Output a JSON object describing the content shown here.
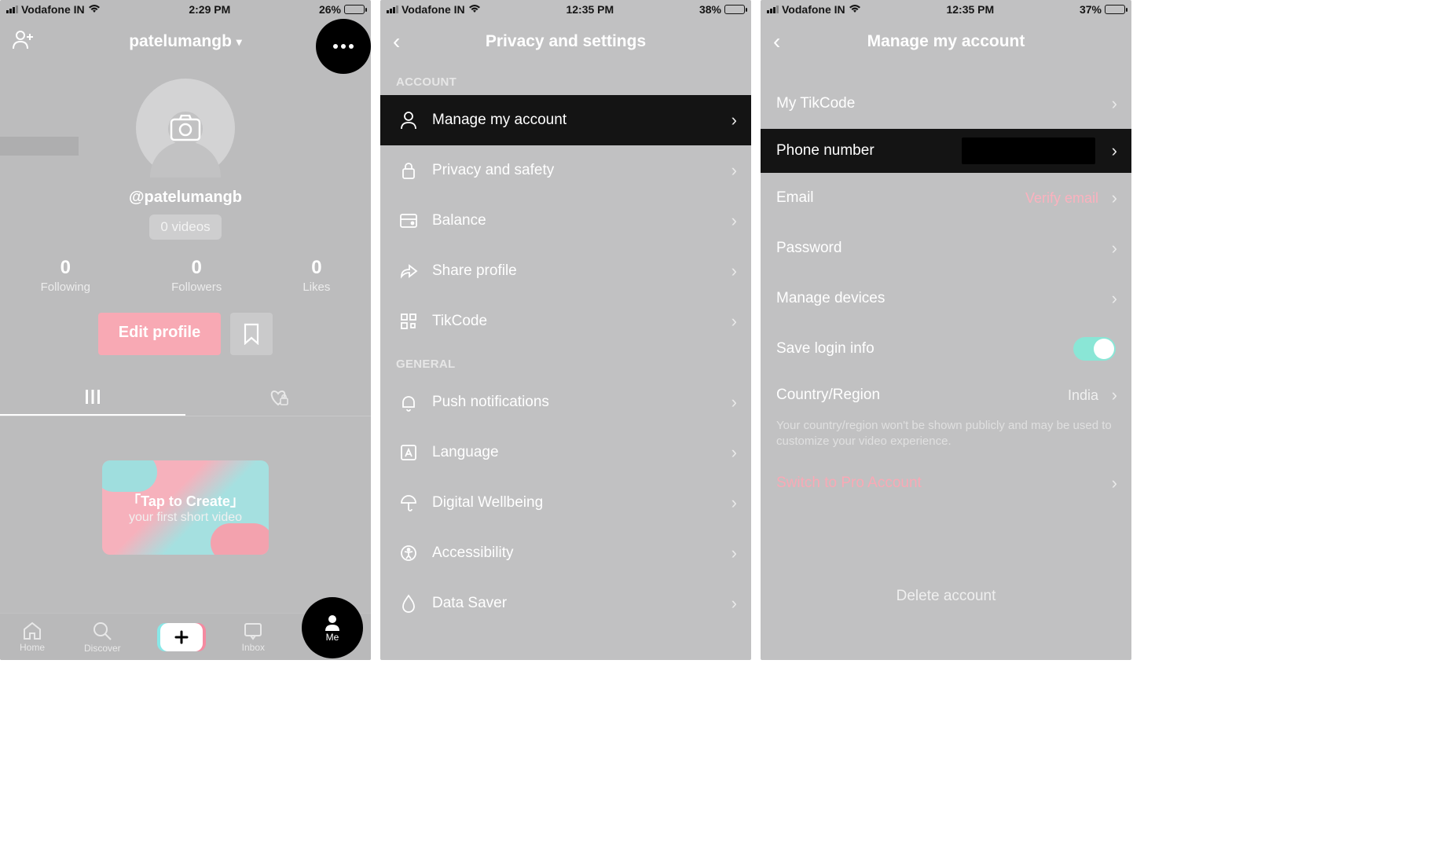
{
  "screen1": {
    "statusbar": {
      "carrier": "Vodafone IN",
      "time": "2:29 PM",
      "battery": "26%"
    },
    "header": {
      "username": "patelumangb"
    },
    "handle": "@patelumangb",
    "videos_pill": "0 videos",
    "stats": {
      "following": {
        "num": "0",
        "label": "Following"
      },
      "followers": {
        "num": "0",
        "label": "Followers"
      },
      "likes": {
        "num": "0",
        "label": "Likes"
      }
    },
    "edit_profile": "Edit profile",
    "create_card": {
      "line1": "「Tap to Create」",
      "line2": "your first short video"
    },
    "nav": {
      "home": "Home",
      "discover": "Discover",
      "inbox": "Inbox",
      "me": "Me"
    }
  },
  "screen2": {
    "statusbar": {
      "carrier": "Vodafone IN",
      "time": "12:35 PM",
      "battery": "38%"
    },
    "title": "Privacy and settings",
    "sections": {
      "account_header": "ACCOUNT",
      "general_header": "GENERAL",
      "items": {
        "manage": "Manage my account",
        "privacy": "Privacy and safety",
        "balance": "Balance",
        "share": "Share profile",
        "tikcode": "TikCode",
        "push": "Push notifications",
        "language": "Language",
        "wellbeing": "Digital Wellbeing",
        "accessibility": "Accessibility",
        "datasaver": "Data Saver"
      }
    }
  },
  "screen3": {
    "statusbar": {
      "carrier": "Vodafone IN",
      "time": "12:35 PM",
      "battery": "37%"
    },
    "title": "Manage my account",
    "items": {
      "tikcode": "My TikCode",
      "phone": "Phone number",
      "email": "Email",
      "email_action": "Verify email",
      "password": "Password",
      "devices": "Manage devices",
      "save_login": "Save login info",
      "country": "Country/Region",
      "country_value": "India",
      "country_note": "Your country/region won't be shown publicly and may be used to customize your video experience.",
      "switch_pro": "Switch to Pro Account",
      "delete": "Delete account"
    }
  }
}
